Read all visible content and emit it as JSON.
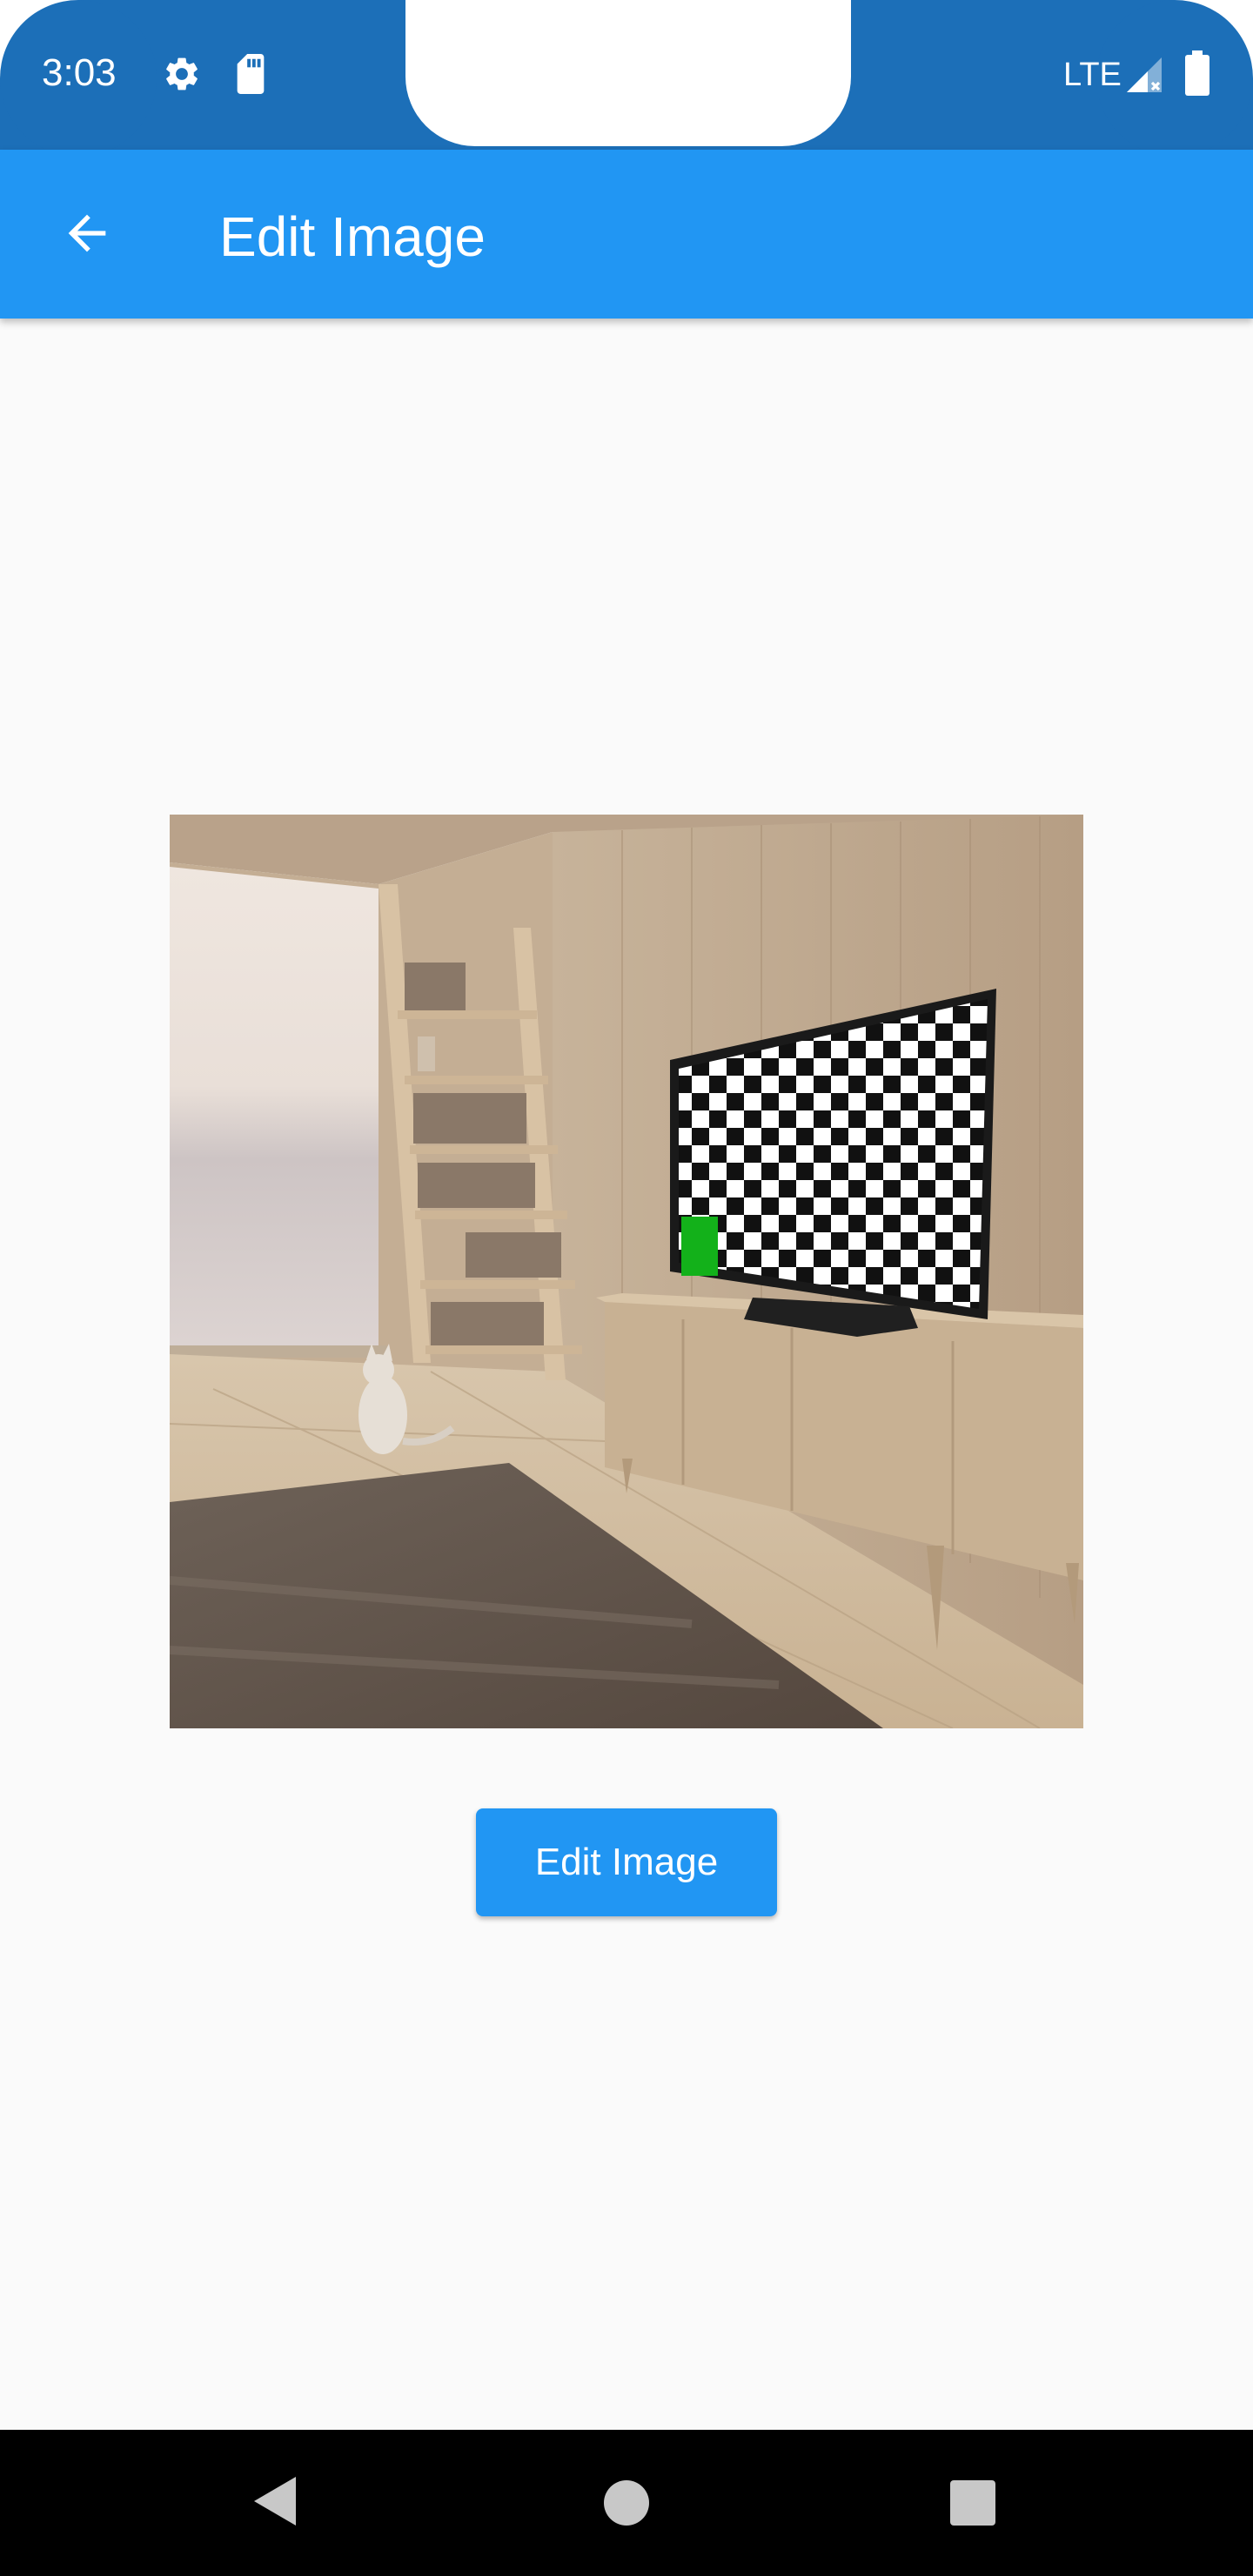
{
  "status_bar": {
    "time": "3:03",
    "network": "LTE",
    "icons": [
      "gear-icon",
      "sd-card-icon",
      "signal-icon",
      "battery-icon"
    ]
  },
  "app_bar": {
    "title": "Edit Image",
    "back_icon": "arrow-back-icon"
  },
  "main": {
    "button_label": "Edit Image"
  },
  "nav_bar": {
    "icons": [
      "nav-back-icon",
      "nav-home-icon",
      "nav-recents-icon"
    ]
  },
  "colors": {
    "status_bar": "#1c6fb8",
    "app_bar": "#2196f3",
    "background": "#fafafa",
    "button": "#2196f3",
    "nav_bar": "#000000"
  }
}
